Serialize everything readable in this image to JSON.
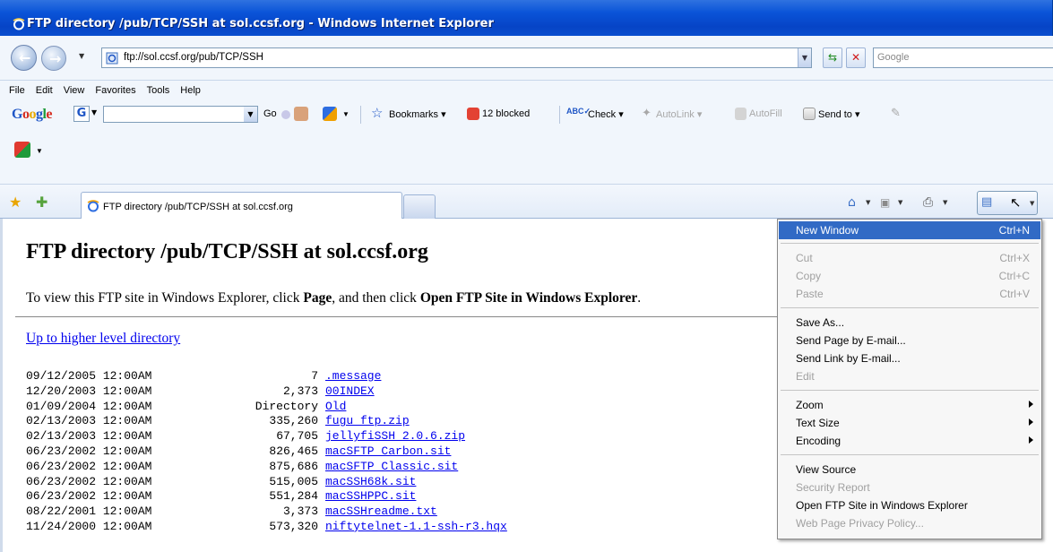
{
  "window": {
    "title": "FTP directory /pub/TCP/SSH at sol.ccsf.org - Windows Internet Explorer"
  },
  "address_bar": {
    "url": "ftp://sol.ccsf.org/pub/TCP/SSH",
    "search_placeholder": "Google"
  },
  "menu_bar": [
    "File",
    "Edit",
    "View",
    "Favorites",
    "Tools",
    "Help"
  ],
  "google_toolbar": {
    "logo": "Google",
    "go_label": "Go",
    "bookmarks_label": "Bookmarks",
    "blocked_label": "12 blocked",
    "check_label": "Check",
    "autolink_label": "AutoLink",
    "autofill_label": "AutoFill",
    "sendto_label": "Send to"
  },
  "tab": {
    "label": "FTP directory /pub/TCP/SSH at sol.ccsf.org"
  },
  "page": {
    "heading": "FTP directory /pub/TCP/SSH at sol.ccsf.org",
    "intro_prefix": "To view this FTP site in Windows Explorer, click ",
    "intro_page": "Page",
    "intro_middle": ", and then click ",
    "intro_open": "Open FTP Site in Windows Explorer",
    "intro_suffix": ".",
    "up_link": "Up to higher level directory",
    "files": [
      {
        "date": "09/12/2005 12:00AM",
        "size": "7",
        "name": ".message"
      },
      {
        "date": "12/20/2003 12:00AM",
        "size": "2,373",
        "name": "00INDEX"
      },
      {
        "date": "01/09/2004 12:00AM",
        "size": "Directory",
        "name": "Old"
      },
      {
        "date": "02/13/2003 12:00AM",
        "size": "335,260",
        "name": "fugu_ftp.zip"
      },
      {
        "date": "02/13/2003 12:00AM",
        "size": "67,705",
        "name": "jellyfiSSH_2.0.6.zip"
      },
      {
        "date": "06/23/2002 12:00AM",
        "size": "826,465",
        "name": "macSFTP_Carbon.sit"
      },
      {
        "date": "06/23/2002 12:00AM",
        "size": "875,686",
        "name": "macSFTP_Classic.sit"
      },
      {
        "date": "06/23/2002 12:00AM",
        "size": "515,005",
        "name": "macSSH68k.sit"
      },
      {
        "date": "06/23/2002 12:00AM",
        "size": "551,284",
        "name": "macSSHPPC.sit"
      },
      {
        "date": "08/22/2001 12:00AM",
        "size": "3,373",
        "name": "macSSHreadme.txt"
      },
      {
        "date": "11/24/2000 12:00AM",
        "size": "573,320",
        "name": "niftytelnet-1.1-ssh-r3.hqx"
      }
    ]
  },
  "context_menu": {
    "new_window": {
      "label": "New Window",
      "shortcut": "Ctrl+N"
    },
    "cut": {
      "label": "Cut",
      "shortcut": "Ctrl+X"
    },
    "copy": {
      "label": "Copy",
      "shortcut": "Ctrl+C"
    },
    "paste": {
      "label": "Paste",
      "shortcut": "Ctrl+V"
    },
    "save_as": "Save As...",
    "send_page": "Send Page by E-mail...",
    "send_link": "Send Link by E-mail...",
    "edit": "Edit",
    "zoom": "Zoom",
    "text_size": "Text Size",
    "encoding": "Encoding",
    "view_source": "View Source",
    "security_report": "Security Report",
    "open_ftp": "Open FTP Site in Windows Explorer",
    "privacy_policy": "Web Page Privacy Policy..."
  },
  "colors": {
    "titlebar": "#0a54d8",
    "menu_highlight": "#316ac5",
    "link": "#0000ee"
  }
}
